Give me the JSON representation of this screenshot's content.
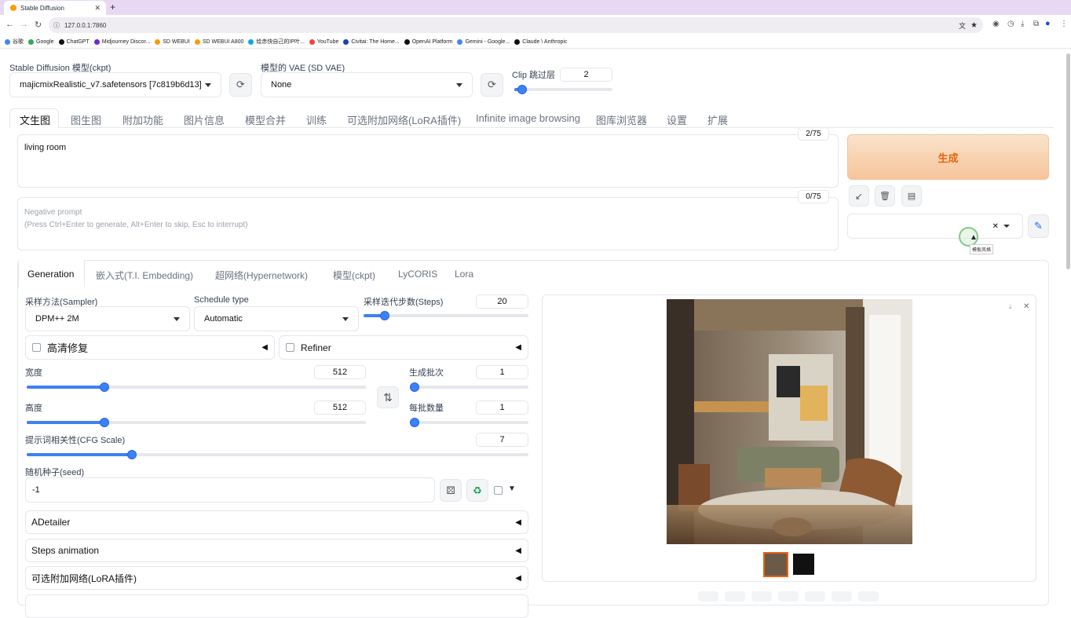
{
  "browser": {
    "tab_title": "Stable Diffusion",
    "url": "127.0.0.1:7860",
    "bookmarks": [
      "谷歌",
      "Google",
      "ChatGPT",
      "Midjourney Discor...",
      "SD WEBUI",
      "SD WEBUI A800",
      "绘赤快自己的IP叶...",
      "YouTube",
      "Civitai: The Home...",
      "OpenAI Platform",
      "Gemini - Google...",
      "Claude \\ Anthropic"
    ]
  },
  "top": {
    "ckpt_label": "Stable Diffusion 模型(ckpt)",
    "ckpt_value": "majicmixRealistic_v7.safetensors [7c819b6d13]",
    "vae_label": "模型的 VAE (SD VAE)",
    "vae_value": "None",
    "clip_label": "Clip 跳过层",
    "clip_value": "2",
    "clip_fraction": 0.08
  },
  "main_tabs": [
    "文生图",
    "图生图",
    "附加功能",
    "图片信息",
    "模型合并",
    "训练",
    "可选附加网络(LoRA插件)",
    "Infinite image browsing",
    "图库浏览器",
    "设置",
    "扩展"
  ],
  "prompt": {
    "positive": "living room",
    "positive_count": "2/75",
    "negative_placeholder": "Negative prompt\n(Press Ctrl+Enter to generate, Alt+Enter to skip, Esc to interrupt)",
    "negative_count": "0/75"
  },
  "generate_label": "生成",
  "style_tooltip": "模板风格",
  "sub_tabs": [
    "Generation",
    "嵌入式(T.I. Embedding)",
    "超网络(Hypernetwork)",
    "模型(ckpt)",
    "LyCORIS",
    "Lora"
  ],
  "params": {
    "sampler_label": "采样方法(Sampler)",
    "sampler_value": "DPM++ 2M",
    "schedule_label": "Schedule type",
    "schedule_value": "Automatic",
    "steps_label": "采样迭代步数(Steps)",
    "steps_value": "20",
    "steps_fraction": 0.13,
    "hires_label": "高清修复",
    "refiner_label": "Refiner",
    "width_label": "宽度",
    "width_value": "512",
    "width_fraction": 0.23,
    "height_label": "高度",
    "height_value": "512",
    "height_fraction": 0.23,
    "batch_count_label": "生成批次",
    "batch_count_value": "1",
    "batch_size_label": "每批数量",
    "batch_size_value": "1",
    "cfg_label": "提示词相关性(CFG Scale)",
    "cfg_value": "7",
    "cfg_fraction": 0.21,
    "seed_label": "随机种子(seed)",
    "seed_value": "-1"
  },
  "accordions": [
    "ADetailer",
    "Steps animation",
    "可选附加网络(LoRA插件)"
  ],
  "colors": {
    "accent": "#3b82f6",
    "generate_bg": "#f7c9a0",
    "generate_text": "#e8650f"
  }
}
